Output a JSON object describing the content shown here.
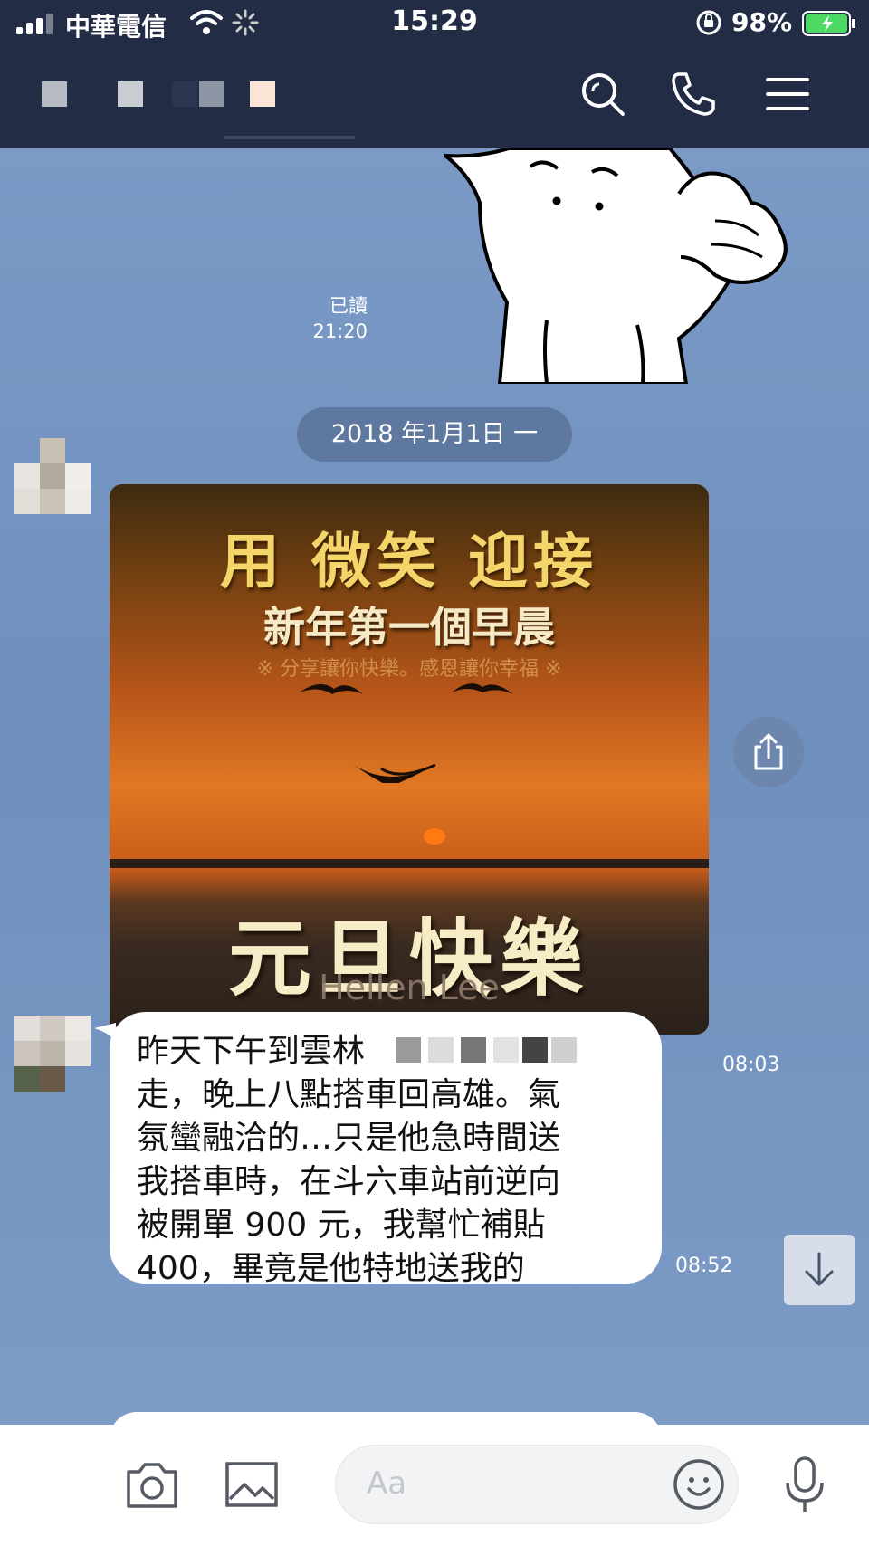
{
  "status_bar": {
    "carrier": "中華電信",
    "time": "15:29",
    "battery": "98%"
  },
  "chat": {
    "read_label": "已讀",
    "read_time": "21:20",
    "date_separator": "2018 年1月1日 一",
    "image_message": {
      "line1": "用 微笑 迎接",
      "line2": "新年第一個早晨",
      "line3": "※ 分享讓你快樂。感恩讓你幸福 ※",
      "line4": "元旦快樂",
      "line5": "Hellen Lee",
      "time": "08:03"
    },
    "text_message": {
      "lines": [
        "昨天下午到雲林",
        "走，晚上八點搭車回高雄。氣",
        "氛蠻融洽的…只是他急時間送",
        "我搭車時，在斗六車站前逆向",
        "被開單 900 元，我幫忙補貼",
        "400，畢竟是他特地送我的"
      ],
      "time": "08:52"
    }
  },
  "input": {
    "placeholder": "Aa"
  },
  "colors": {
    "header_bg": "#222c45",
    "chat_bg": "#7796c0",
    "bubble_bg": "#ffffff"
  },
  "icons": {
    "header": [
      "search-icon",
      "phone-icon",
      "menu-icon"
    ],
    "chat": [
      "share-icon",
      "scroll-down-icon"
    ],
    "bottom": [
      "camera-icon",
      "image-icon",
      "emoji-icon",
      "microphone-icon"
    ]
  }
}
